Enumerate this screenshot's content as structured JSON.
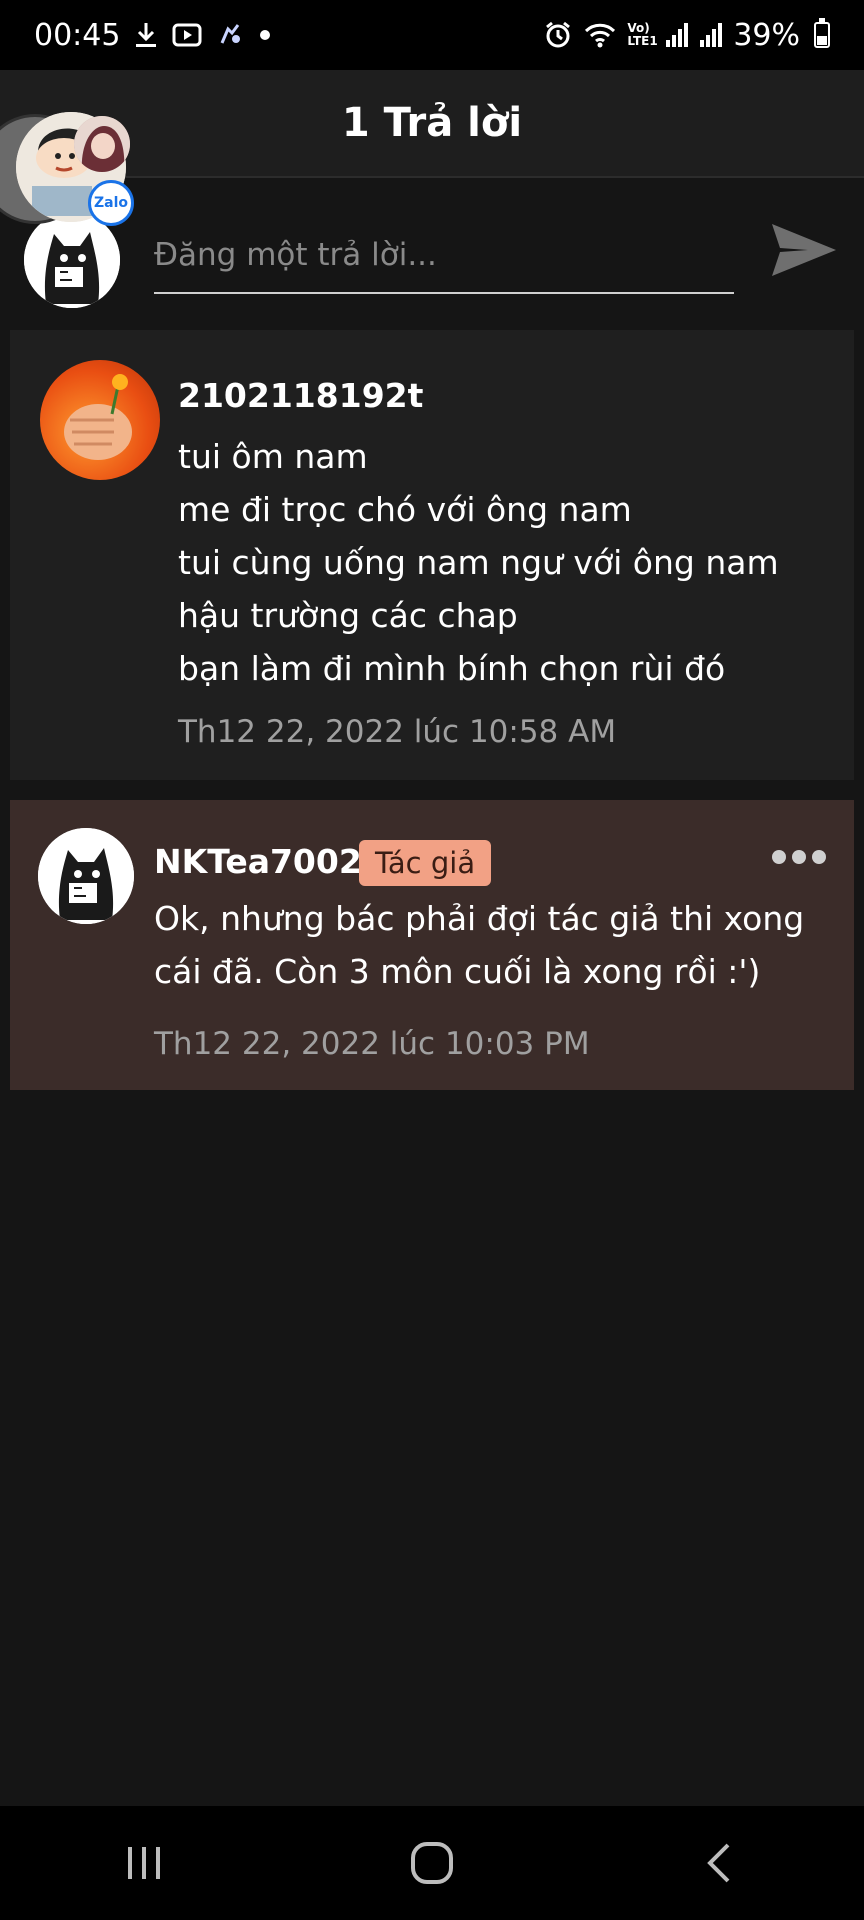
{
  "status_bar": {
    "time": "00:45",
    "lte_label": "Vo) LTE1",
    "battery": "39%",
    "battery_level": 0.39,
    "left_icons": [
      "download-icon",
      "youtube-icon",
      "game-icon",
      "dot-icon"
    ],
    "right_icons": [
      "alarm-icon",
      "wifi-icon",
      "signal-icon",
      "signal-icon",
      "battery-icon"
    ]
  },
  "header": {
    "title": "1 Trả lời"
  },
  "chat_heads": {
    "badge_label": "Zalo"
  },
  "reply_input": {
    "placeholder": "Đăng một trả lời..."
  },
  "original_comment": {
    "username": "2102118192t",
    "lines": [
      "tui ôm nam",
      "me đi trọc chó với ông nam",
      "tui cùng uống  nam ngư với ông nam",
      "hậu trường các chap",
      "bạn làm đi mình bính chọn rùi đó"
    ],
    "timestamp": "Th12 22, 2022 lúc 10:58 AM"
  },
  "reply_comment": {
    "username": "NKTea7002",
    "badge": "Tác giả",
    "body": "Ok, nhưng bác phải đợi tác giả thi xong cái đã. Còn 3 môn cuối là xong rồi :')",
    "timestamp": "Th12 22, 2022 lúc 10:03 PM"
  },
  "nav_bar": {
    "icons": [
      "recent-apps-icon",
      "home-icon",
      "back-icon"
    ]
  },
  "colors": {
    "background": "#151515",
    "card_original": "#1f1f1f",
    "card_reply": "#3b2c29",
    "author_badge": "#f2a185",
    "timestamp": "#a0a0a0"
  }
}
